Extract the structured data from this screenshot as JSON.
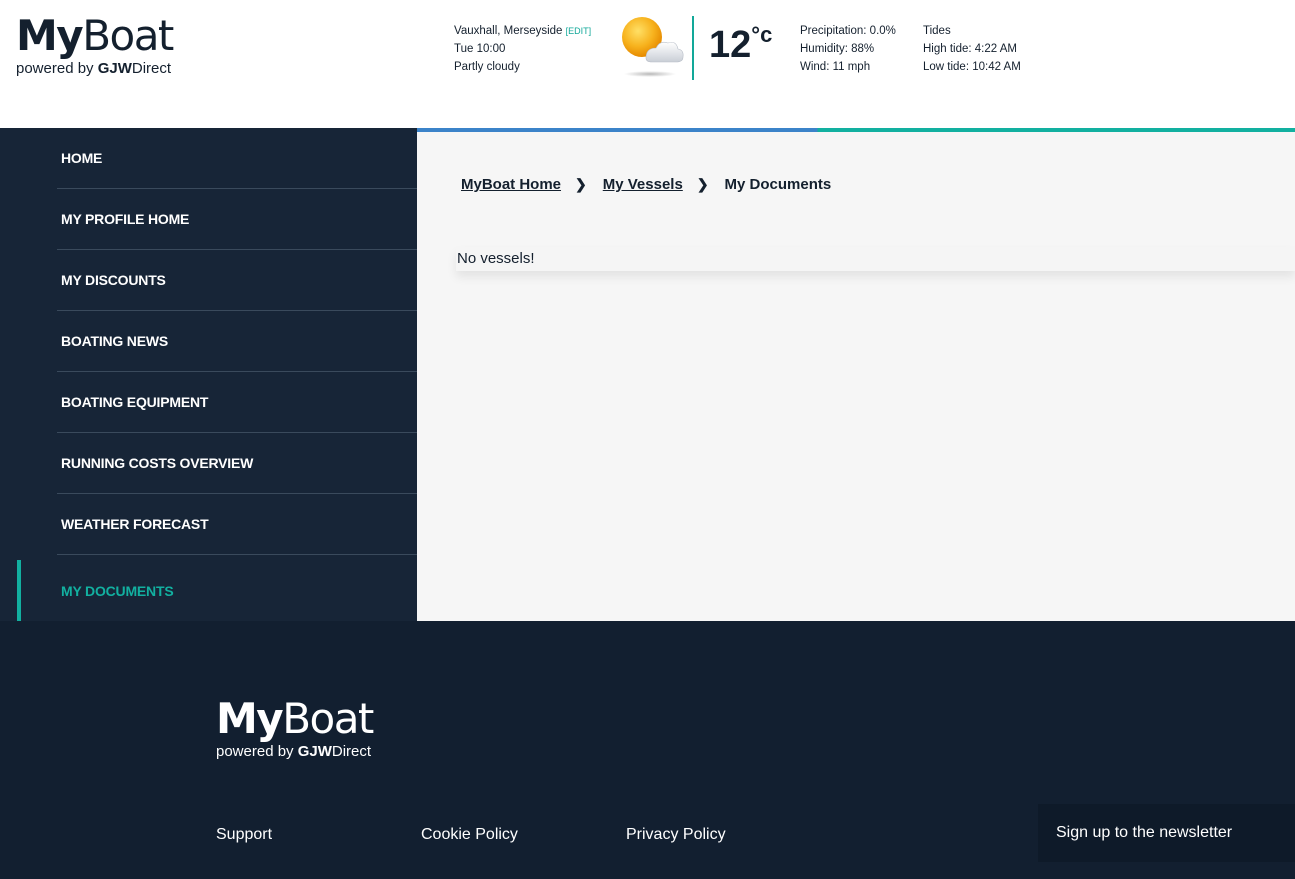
{
  "brand": {
    "logo_bold": "My",
    "logo_light": "Boat",
    "powered_by": "powered by ",
    "powered_bold": "GJW",
    "powered_light": "Direct"
  },
  "weather": {
    "location": "Vauxhall, Merseyside",
    "edit_label": "[EDIT]",
    "datetime": "Tue 10:00",
    "condition": "Partly cloudy",
    "icon": "partly-cloudy-icon",
    "temperature": "12",
    "unit": "°c",
    "precipitation": "Precipitation: 0.0%",
    "humidity": "Humidity: 88%",
    "wind": "Wind: 11 mph",
    "tides_title": "Tides",
    "high_tide": "High tide: 4:22 AM",
    "low_tide": "Low tide: 10:42 AM"
  },
  "colors": {
    "navy": "#172537",
    "footer_navy": "#121f30",
    "accent_teal": "#12b0a0",
    "accent_blue": "#3b83c9"
  },
  "sidebar": {
    "items": [
      {
        "label": "HOME"
      },
      {
        "label": "MY PROFILE HOME"
      },
      {
        "label": "MY DISCOUNTS"
      },
      {
        "label": "BOATING NEWS"
      },
      {
        "label": "BOATING EQUIPMENT"
      },
      {
        "label": "RUNNING COSTS OVERVIEW"
      },
      {
        "label": "WEATHER FORECAST"
      },
      {
        "label": "MY DOCUMENTS"
      }
    ],
    "active_index": 7
  },
  "breadcrumb": {
    "home": "MyBoat Home",
    "vessels": "My Vessels",
    "current": "My Documents",
    "separator": "❯"
  },
  "main": {
    "empty_message": "No vessels!"
  },
  "footer": {
    "links": {
      "support": "Support",
      "cookie": "Cookie Policy",
      "privacy": "Privacy Policy"
    },
    "newsletter": "Sign up to the newsletter"
  }
}
